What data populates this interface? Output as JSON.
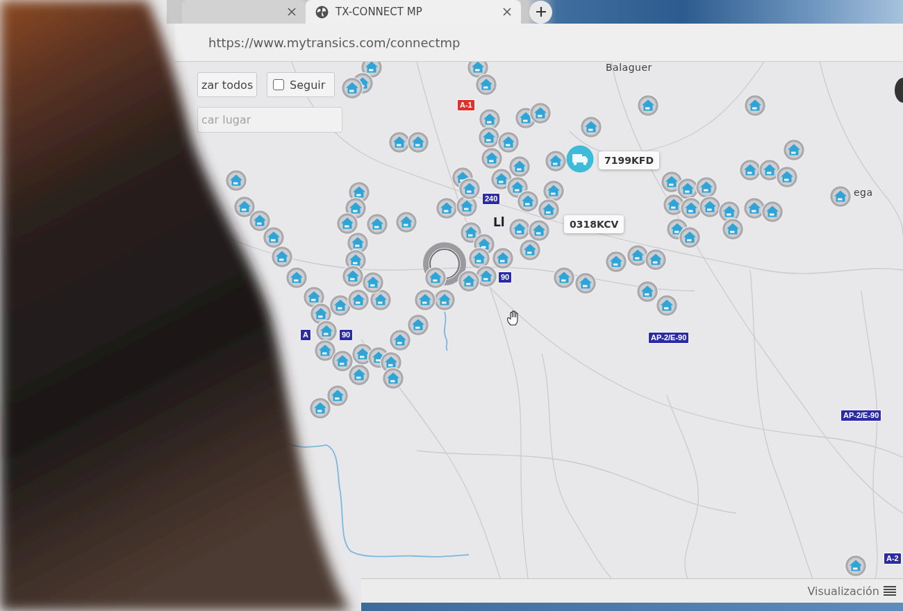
{
  "browser": {
    "tabs": [
      {
        "selected": false
      },
      {
        "label": "TX-CONNECT MP",
        "selected": true
      }
    ],
    "address": "https://www.mytransics.com/connectmp"
  },
  "map_controls": {
    "locate_button": "zar todos",
    "follow": {
      "label": "Seguir",
      "checked": false
    },
    "search": {
      "placeholder": "car lugar"
    }
  },
  "map": {
    "place_labels": [
      "Balaguer",
      "Ll",
      "ega"
    ],
    "road_labels": [
      {
        "text": "A-1",
        "color": "#e0302a"
      },
      {
        "text": "240",
        "color": "#2b2ba6"
      },
      {
        "text": "90",
        "color": "#2b2ba6"
      },
      {
        "text": "A",
        "color": "#2b2ba6"
      },
      {
        "text": "90",
        "color": "#2b2ba6"
      },
      {
        "text": "AP-2/E-90",
        "color": "#2b2ba6"
      },
      {
        "text": "AP-2/E-90",
        "color": "#2b2ba6"
      },
      {
        "text": "A-2",
        "color": "#2b2ba6"
      }
    ],
    "vehicles": [
      {
        "plate": "7199KFD",
        "kind": "truck"
      },
      {
        "plate": "0318KCV",
        "kind": "label"
      }
    ]
  },
  "footer": {
    "view_menu": "Visualización"
  }
}
